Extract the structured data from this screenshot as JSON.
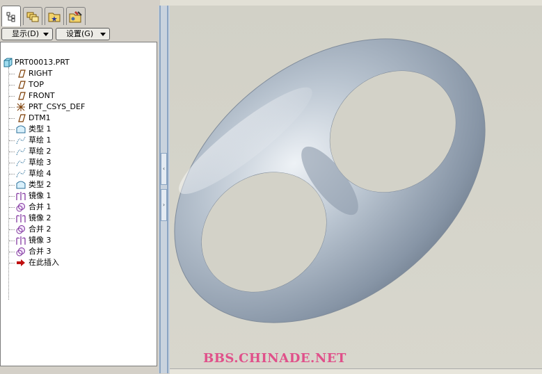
{
  "tabs": [
    {
      "icon": "model-tree-icon",
      "active": true
    },
    {
      "icon": "folder-browser-icon",
      "active": false
    },
    {
      "icon": "favorites-icon",
      "active": false
    },
    {
      "icon": "connections-icon",
      "active": false
    }
  ],
  "menus": {
    "display_label": "显示(D)",
    "settings_label": "设置(G)"
  },
  "tree": {
    "root": {
      "label": "PRT00013.PRT",
      "icon": "part-icon"
    },
    "items": [
      {
        "label": "RIGHT",
        "icon": "datum-plane-icon"
      },
      {
        "label": "TOP",
        "icon": "datum-plane-icon"
      },
      {
        "label": "FRONT",
        "icon": "datum-plane-icon"
      },
      {
        "label": "PRT_CSYS_DEF",
        "icon": "coordinate-system-icon"
      },
      {
        "label": "DTM1",
        "icon": "datum-plane-icon"
      },
      {
        "label": "类型 1",
        "icon": "surface-feature-icon"
      },
      {
        "label": "草绘 1",
        "icon": "sketch-icon"
      },
      {
        "label": "草绘 2",
        "icon": "sketch-icon"
      },
      {
        "label": "草绘 3",
        "icon": "sketch-icon"
      },
      {
        "label": "草绘 4",
        "icon": "sketch-icon"
      },
      {
        "label": "类型 2",
        "icon": "surface-feature-icon"
      },
      {
        "label": "镜像 1",
        "icon": "mirror-icon"
      },
      {
        "label": "合并 1",
        "icon": "merge-icon"
      },
      {
        "label": "镜像 2",
        "icon": "mirror-icon"
      },
      {
        "label": "合并 2",
        "icon": "merge-icon"
      },
      {
        "label": "镜像 3",
        "icon": "mirror-icon"
      },
      {
        "label": "合并 3",
        "icon": "merge-icon"
      },
      {
        "label": "在此插入",
        "icon": "insert-here-arrow-icon"
      }
    ]
  },
  "colors": {
    "model_surface": "#a9b5c4",
    "viewport_bg": "#d3d2c8",
    "watermark": "#e0508a",
    "sash": "#c9d3de"
  },
  "watermark": "BBS.CHINADE.NET"
}
